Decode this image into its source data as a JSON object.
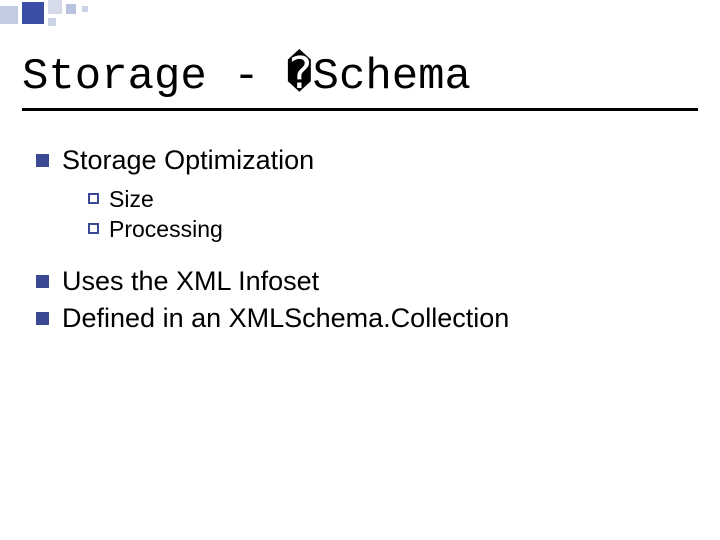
{
  "title": "Storage - �Schema",
  "items": [
    {
      "text": "Storage Optimization",
      "children": [
        {
          "text": "Size"
        },
        {
          "text": "Processing"
        }
      ]
    },
    {
      "text": "Uses the XML Infoset",
      "children": []
    },
    {
      "text": "Defined in an XMLSchema.Collection",
      "children": []
    }
  ]
}
